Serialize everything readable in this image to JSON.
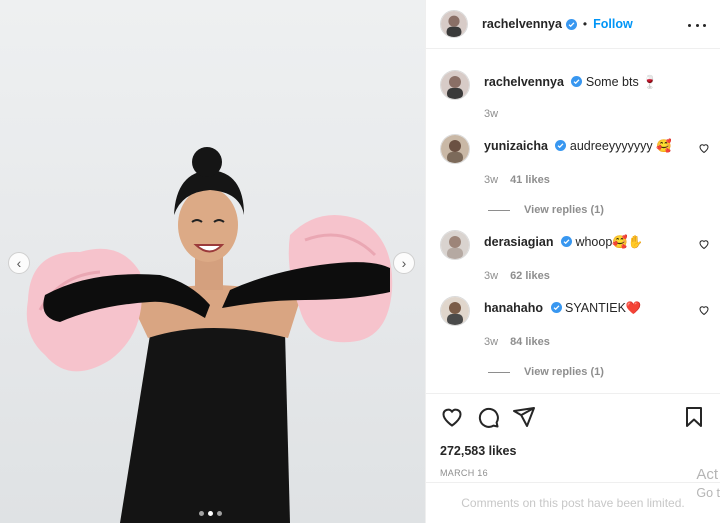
{
  "post": {
    "author": "rachelvennya",
    "follow_label": "Follow",
    "separator": "•",
    "caption_text": "Some bts",
    "caption_emoji": "🍷",
    "caption_time": "3w",
    "likes": "272,583 likes",
    "date": "MARCH 16",
    "comments_limited": "Comments on this post have been limited.",
    "carousel": {
      "current": 2,
      "total": 3
    }
  },
  "comments": [
    {
      "username": "yunizaicha",
      "text": "audreeyyyyyyy 🥰",
      "time": "3w",
      "likes": "41 likes",
      "replies": "View replies (1)"
    },
    {
      "username": "derasiagian",
      "text": "whoop🥰✋",
      "time": "3w",
      "likes": "62 likes",
      "replies": ""
    },
    {
      "username": "hanahaho",
      "text": "SYANTIEK❤️",
      "time": "3w",
      "likes": "84 likes",
      "replies": "View replies (1)"
    }
  ],
  "watermark": {
    "line1": "Act",
    "line2": "Go t"
  },
  "colors": {
    "accent": "#0095f6",
    "text": "#262626",
    "muted": "#8e8e8e",
    "verified": "#3897f0"
  },
  "icons": [
    "more-options-icon",
    "verified-icon",
    "heart-icon",
    "comment-icon",
    "share-icon",
    "bookmark-icon",
    "chevron-left-icon",
    "chevron-right-icon"
  ]
}
